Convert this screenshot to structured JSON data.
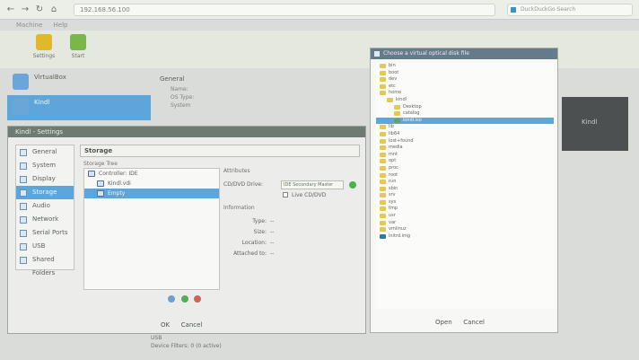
{
  "browser": {
    "url_text": "192.168.56.100",
    "search_placeholder": "DuckDuckGo Search"
  },
  "menu": [
    "Machine",
    "Help"
  ],
  "toolbar": {
    "buttons": [
      {
        "label": "Settings",
        "color": "#e2b82b"
      },
      {
        "label": "Start",
        "color": "#78b84a"
      }
    ]
  },
  "vm_list": [
    {
      "name": "VirtualBox",
      "selected": false
    },
    {
      "name": "Kindl",
      "selected": true
    }
  ],
  "details": {
    "heading": "General",
    "lines": [
      "Name:",
      "OS Type:",
      "System"
    ]
  },
  "preview": {
    "label": "Kindl"
  },
  "settings": {
    "title": "Kindl - Settings",
    "section_title": "Storage",
    "sidebar": [
      {
        "label": "General",
        "selected": false
      },
      {
        "label": "System",
        "selected": false
      },
      {
        "label": "Display",
        "selected": false
      },
      {
        "label": "Storage",
        "selected": true
      },
      {
        "label": "Audio",
        "selected": false
      },
      {
        "label": "Network",
        "selected": false
      },
      {
        "label": "Serial Ports",
        "selected": false
      },
      {
        "label": "USB",
        "selected": false
      },
      {
        "label": "Shared Folders",
        "selected": false
      }
    ],
    "storage_tree_label": "Storage Tree",
    "storage_tree": [
      {
        "label": "Controller: IDE",
        "level": 0,
        "selected": false
      },
      {
        "label": "Kindl.vdi",
        "level": 1,
        "selected": false
      },
      {
        "label": "Empty",
        "level": 1,
        "selected": true
      }
    ],
    "attributes": {
      "heading": "Attributes",
      "optical_drive_label": "CD/DVD Drive:",
      "optical_drive_value": "IDE Secondary Master",
      "live_cd": "Live CD/DVD",
      "info_heading": "Information",
      "rows": [
        {
          "label": "Type:",
          "value": "--"
        },
        {
          "label": "Size:",
          "value": "--"
        },
        {
          "label": "Location:",
          "value": "--"
        },
        {
          "label": "Attached to:",
          "value": "--"
        }
      ]
    },
    "ok": "OK",
    "cancel": "Cancel"
  },
  "chooser": {
    "title": "Choose a virtual optical disk file",
    "items": [
      {
        "label": "bin",
        "depth": 0,
        "selected": false
      },
      {
        "label": "boot",
        "depth": 0,
        "selected": false
      },
      {
        "label": "dev",
        "depth": 0,
        "selected": false
      },
      {
        "label": "etc",
        "depth": 0,
        "selected": false
      },
      {
        "label": "home",
        "depth": 0,
        "selected": false
      },
      {
        "label": "kindl",
        "depth": 1,
        "selected": false
      },
      {
        "label": "Desktop",
        "depth": 2,
        "selected": false
      },
      {
        "label": "catalog",
        "depth": 2,
        "selected": false
      },
      {
        "label": "kindl.iso",
        "depth": 2,
        "selected": true,
        "icon": "disk"
      },
      {
        "label": "lib",
        "depth": 0,
        "selected": false
      },
      {
        "label": "lib64",
        "depth": 0,
        "selected": false
      },
      {
        "label": "lost+found",
        "depth": 0,
        "selected": false
      },
      {
        "label": "media",
        "depth": 0,
        "selected": false
      },
      {
        "label": "mnt",
        "depth": 0,
        "selected": false
      },
      {
        "label": "opt",
        "depth": 0,
        "selected": false
      },
      {
        "label": "proc",
        "depth": 0,
        "selected": false
      },
      {
        "label": "root",
        "depth": 0,
        "selected": false
      },
      {
        "label": "run",
        "depth": 0,
        "selected": false
      },
      {
        "label": "sbin",
        "depth": 0,
        "selected": false
      },
      {
        "label": "srv",
        "depth": 0,
        "selected": false
      },
      {
        "label": "sys",
        "depth": 0,
        "selected": false
      },
      {
        "label": "tmp",
        "depth": 0,
        "selected": false
      },
      {
        "label": "usr",
        "depth": 0,
        "selected": false
      },
      {
        "label": "var",
        "depth": 0,
        "selected": false
      },
      {
        "label": "vmlinuz",
        "depth": 0,
        "selected": false
      },
      {
        "label": "initrd.img",
        "depth": 0,
        "selected": false,
        "icon": "file"
      }
    ],
    "open": "Open",
    "cancel": "Cancel"
  },
  "bottom_info": {
    "title": "USB",
    "line": "Device Filters: 0 (0 active)"
  }
}
